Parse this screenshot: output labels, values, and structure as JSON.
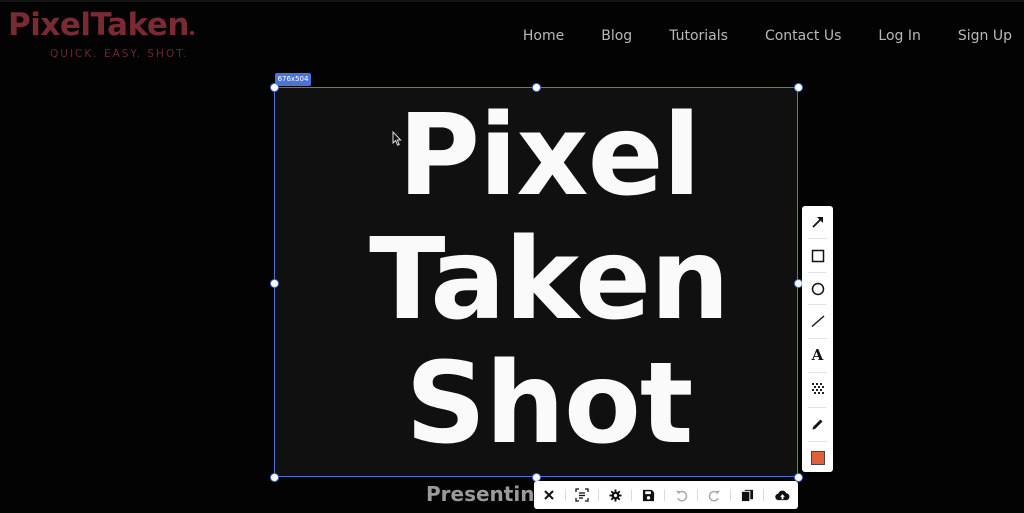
{
  "site": {
    "logo_text": "PixelTaken",
    "tagline": "QUICK. EASY. SHOT.",
    "brand_color": "#7a2a33"
  },
  "nav": {
    "items": [
      "Home",
      "Blog",
      "Tutorials",
      "Contact Us",
      "Log In",
      "Sign Up"
    ]
  },
  "selection": {
    "size_label": "676x504",
    "accent_color": "#4a74d6"
  },
  "hero": {
    "lines": [
      "Pixel",
      "Taken",
      "Shot"
    ]
  },
  "below_text": "Presenting",
  "side_tools": [
    {
      "name": "arrow-icon"
    },
    {
      "name": "rectangle-icon"
    },
    {
      "name": "ellipse-icon"
    },
    {
      "name": "line-icon"
    },
    {
      "name": "text-icon",
      "glyph": "A"
    },
    {
      "name": "blur-icon"
    },
    {
      "name": "pencil-icon"
    },
    {
      "name": "color-swatch-icon",
      "color": "#e0603a"
    }
  ],
  "bottom_tools": [
    {
      "name": "close-icon"
    },
    {
      "name": "ocr-icon"
    },
    {
      "name": "settings-icon"
    },
    {
      "name": "save-icon"
    },
    {
      "name": "undo-icon"
    },
    {
      "name": "redo-icon"
    },
    {
      "name": "copy-icon"
    },
    {
      "name": "upload-cloud-icon"
    }
  ]
}
